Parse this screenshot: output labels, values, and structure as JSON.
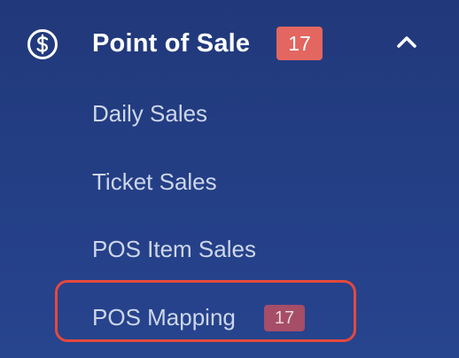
{
  "nav": {
    "section": {
      "title": "Point of Sale",
      "badge": "17",
      "icon": "dollar-circle-icon",
      "toggle_icon": "chevron-up-icon",
      "expanded": true
    },
    "items": [
      {
        "label": "Daily Sales"
      },
      {
        "label": "Ticket Sales"
      },
      {
        "label": "POS Item Sales"
      },
      {
        "label": "POS Mapping",
        "badge": "17",
        "highlighted": true
      }
    ]
  },
  "colors": {
    "background": "#233e84",
    "badge_primary": "#e36660",
    "badge_secondary": "#a64d68",
    "highlight_outline": "#e4493d",
    "item_text": "#cdd6ea"
  }
}
